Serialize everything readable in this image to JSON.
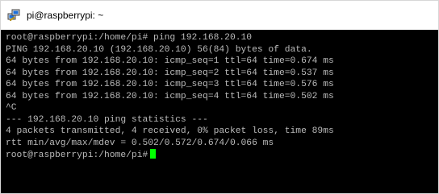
{
  "window": {
    "title": "pi@raspberrypi: ~",
    "icon": "putty-icon"
  },
  "terminal": {
    "colors": {
      "background": "#000000",
      "foreground": "#bbbbbb",
      "cursor": "#00ff00"
    },
    "lines": [
      "root@raspberrypi:/home/pi# ping 192.168.20.10",
      "PING 192.168.20.10 (192.168.20.10) 56(84) bytes of data.",
      "64 bytes from 192.168.20.10: icmp_seq=1 ttl=64 time=0.674 ms",
      "64 bytes from 192.168.20.10: icmp_seq=2 ttl=64 time=0.537 ms",
      "64 bytes from 192.168.20.10: icmp_seq=3 ttl=64 time=0.576 ms",
      "64 bytes from 192.168.20.10: icmp_seq=4 ttl=64 time=0.502 ms",
      "^C",
      "--- 192.168.20.10 ping statistics ---",
      "4 packets transmitted, 4 received, 0% packet loss, time 89ms",
      "rtt min/avg/max/mdev = 0.502/0.572/0.674/0.066 ms"
    ],
    "prompt": "root@raspberrypi:/home/pi#"
  }
}
